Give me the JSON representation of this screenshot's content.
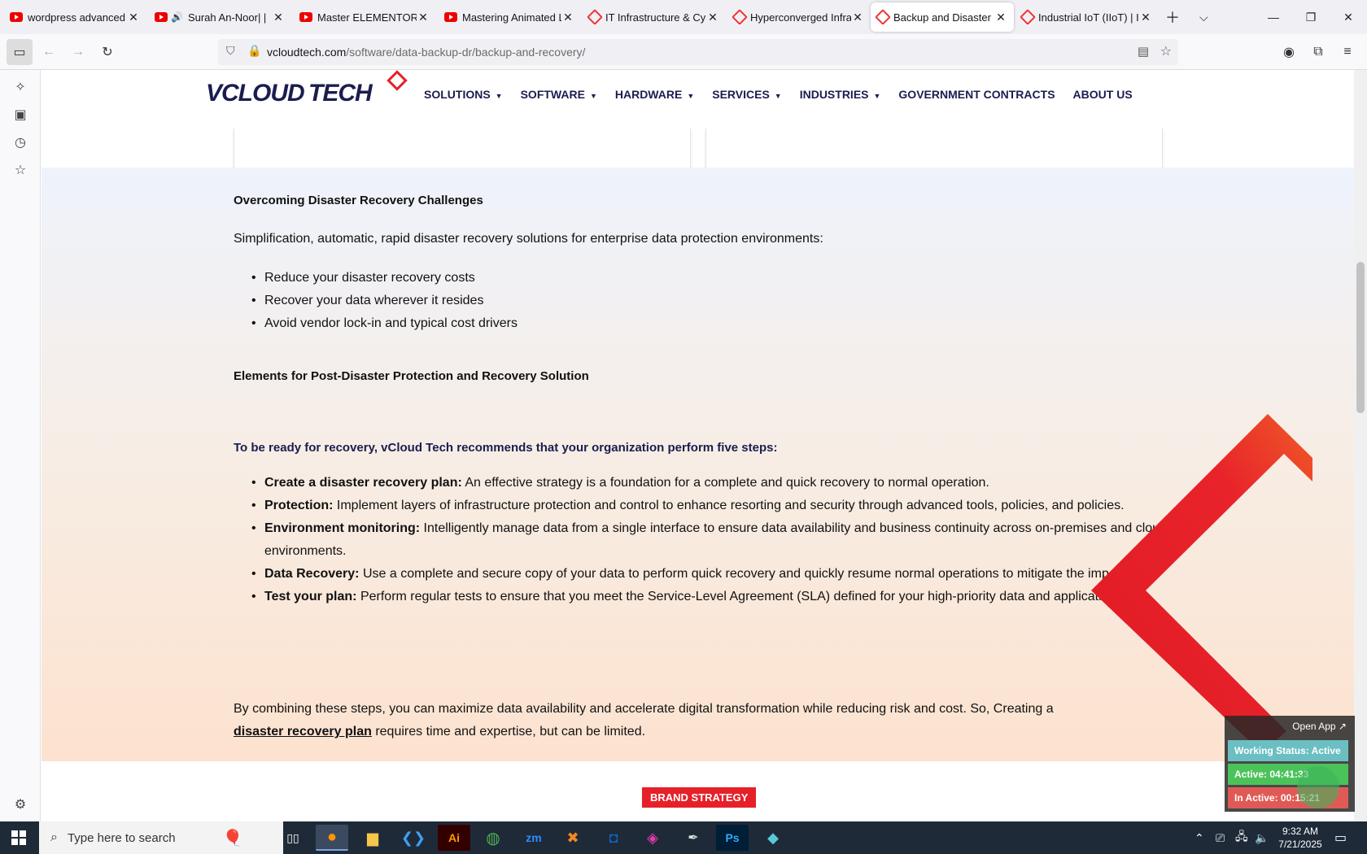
{
  "browser": {
    "tabs": [
      {
        "label": "wordpress advanced ar",
        "icon": "youtube-icon",
        "active": false
      },
      {
        "label": "Surah An-Noor| |",
        "icon": "youtube-icon",
        "active": false,
        "audio": true
      },
      {
        "label": "Master ELEMENTOR: Bi",
        "icon": "youtube-icon",
        "active": false
      },
      {
        "label": "Mastering Animated La",
        "icon": "youtube-icon",
        "active": false
      },
      {
        "label": "IT Infrastructure & Cyb",
        "icon": "vcloud-icon",
        "active": false
      },
      {
        "label": "Hyperconverged Infras",
        "icon": "vcloud-icon",
        "active": false
      },
      {
        "label": "Backup and Disaster Re",
        "icon": "vcloud-icon",
        "active": true
      },
      {
        "label": "Industrial IoT (IIoT) | Io",
        "icon": "vcloud-icon",
        "active": false
      }
    ],
    "url_host": "vcloudtech.com",
    "url_path": "/software/data-backup-dr/backup-and-recovery/"
  },
  "site": {
    "logo_part1": "VCLOUD",
    "logo_part2": "TECH",
    "menu": [
      {
        "label": "SOLUTIONS",
        "caret": true
      },
      {
        "label": "SOFTWARE",
        "caret": true
      },
      {
        "label": "HARDWARE",
        "caret": true
      },
      {
        "label": "SERVICES",
        "caret": true
      },
      {
        "label": "INDUSTRIES",
        "caret": true
      },
      {
        "label": "GOVERNMENT CONTRACTS",
        "caret": false
      },
      {
        "label": "ABOUT US",
        "caret": false
      }
    ]
  },
  "content": {
    "heading1": "Overcoming Disaster Recovery Challenges",
    "intro": "Simplification, automatic, rapid disaster recovery solutions for enterprise data protection environments:",
    "bullets1": [
      "Reduce your disaster recovery costs",
      "Recover your data wherever it resides",
      "Avoid vendor lock-in and typical cost drivers"
    ],
    "heading2": "Elements for Post-Disaster Protection and Recovery Solution",
    "lead": "To be ready for recovery, vCloud Tech recommends that your organization perform five steps:",
    "steps": [
      {
        "title": "Create a disaster recovery plan:",
        "text": " An effective strategy is a foundation for a complete and quick recovery to normal operation."
      },
      {
        "title": "Protection:",
        "text": " Implement layers of infrastructure protection and control to enhance resorting and security through advanced tools, policies, and policies."
      },
      {
        "title": "Environment monitoring:",
        "text": " Intelligently manage data from a single interface to ensure data availability and business continuity across on-premises and cloud environments."
      },
      {
        "title": "Data Recovery:",
        "text": " Use a complete and secure copy of your data to perform quick recovery and quickly resume normal operations to mitigate the impact."
      },
      {
        "title": "Test your plan:",
        "text": " Perform regular tests to ensure that you meet the Service-Level Agreement (SLA) defined for your high-priority data and applications."
      }
    ],
    "closing_before": "By combining these steps, you can maximize data availability and accelerate digital transformation while reducing risk and cost. So, Creating a",
    "closing_link": "disaster recovery plan",
    "closing_after": " requires time and expertise, but can be limited.",
    "badge": "BRAND STRATEGY"
  },
  "tracker": {
    "open_app": "Open App ↗",
    "status": "Working Status: Active",
    "active": "Active: 04:41:33",
    "inactive": "In Active: 00:15:21"
  },
  "taskbar": {
    "search_placeholder": "Type here to search",
    "time": "9:32 AM",
    "date": "7/21/2025"
  },
  "colors": {
    "brand_navy": "#1b1d4f",
    "brand_red": "#e62029"
  }
}
